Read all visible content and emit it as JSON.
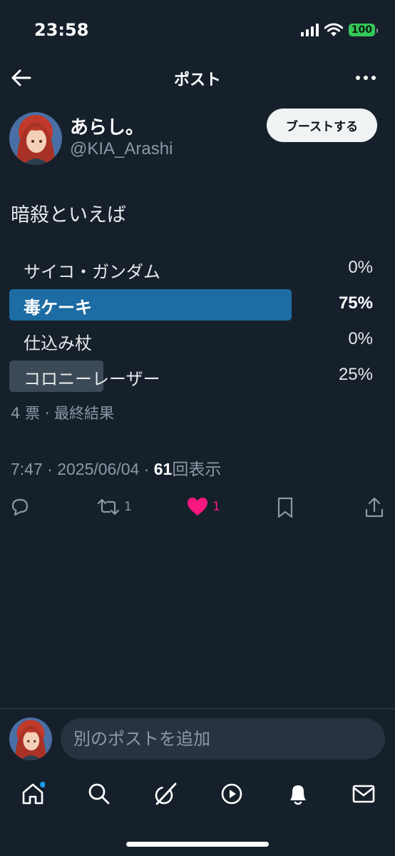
{
  "status_bar": {
    "time": "23:58",
    "battery": "100"
  },
  "header": {
    "title": "ポスト"
  },
  "author": {
    "name": "あらし。",
    "handle": "@KIA_Arashi",
    "boost_label": "ブーストする"
  },
  "post": {
    "text": "暗殺といえば"
  },
  "poll": {
    "options": [
      {
        "label": "サイコ・ガンダム",
        "percent": "0%",
        "fill": 0.0
      },
      {
        "label": "毒ケーキ",
        "percent": "75%",
        "fill": 0.75
      },
      {
        "label": "仕込み杖",
        "percent": "0%",
        "fill": 0.0
      },
      {
        "label": "コロニーレーザー",
        "percent": "25%",
        "fill": 0.25
      }
    ],
    "meta": "4 票 · 最終結果"
  },
  "timestamp": {
    "time_date": "7:47 · 2025/06/04 · ",
    "views": "61",
    "views_label": "回表示"
  },
  "actions": {
    "retweets": "1",
    "likes": "1"
  },
  "reply": {
    "placeholder": "別のポストを追加"
  },
  "colors": {
    "background": "#15202b",
    "winner_bar": "#1d6ca3",
    "other_bar": "#3c4a57",
    "like": "#f91880",
    "battery": "#34c759"
  },
  "icons": [
    "back-arrow-icon",
    "more-icon",
    "reply-icon",
    "retweet-icon",
    "heart-icon",
    "bookmark-icon",
    "share-icon",
    "home-icon",
    "search-icon",
    "grok-icon",
    "video-icon",
    "notifications-icon",
    "messages-icon"
  ]
}
